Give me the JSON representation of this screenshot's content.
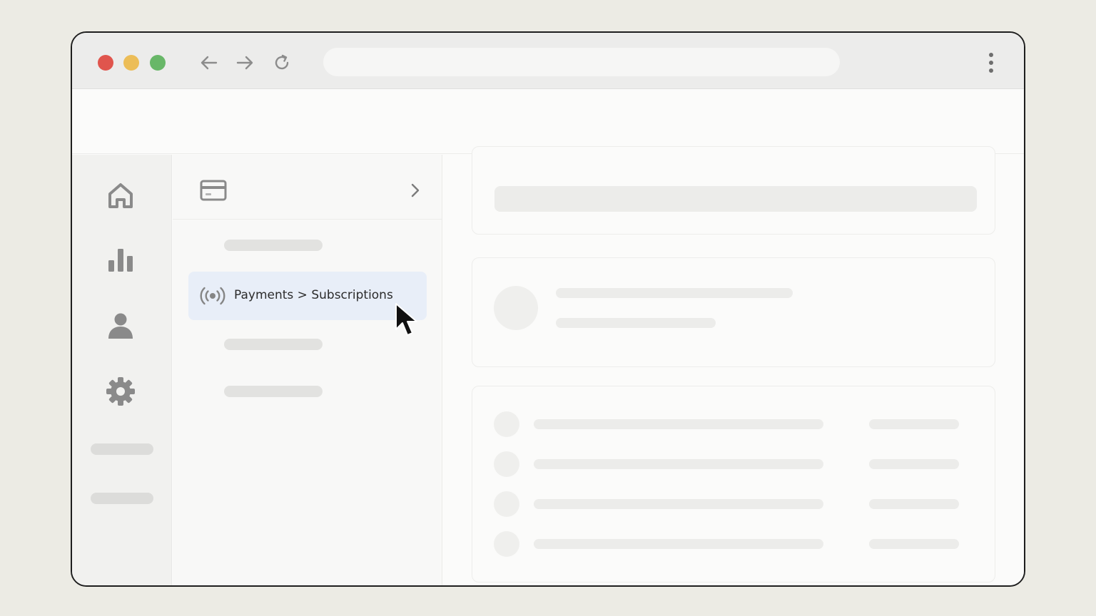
{
  "browser": {
    "icons": [
      "back-arrow-icon",
      "forward-arrow-icon",
      "reload-icon",
      "more-vertical-icon"
    ],
    "window_controls": {
      "close": "#e0554d",
      "minimize": "#ecbd57",
      "maximize": "#68b768"
    }
  },
  "sidebar": {
    "icons": [
      "home-icon",
      "bar-chart-icon",
      "user-icon",
      "settings-gear-icon"
    ]
  },
  "panel": {
    "header_icon": "credit-card-icon",
    "expand_icon": "chevron-right-icon",
    "active_item": {
      "icon": "broadcast-icon",
      "label": "Payments > Subscriptions"
    }
  },
  "colors": {
    "active_highlight": "#e8eef8",
    "background": "#ecebe4"
  }
}
